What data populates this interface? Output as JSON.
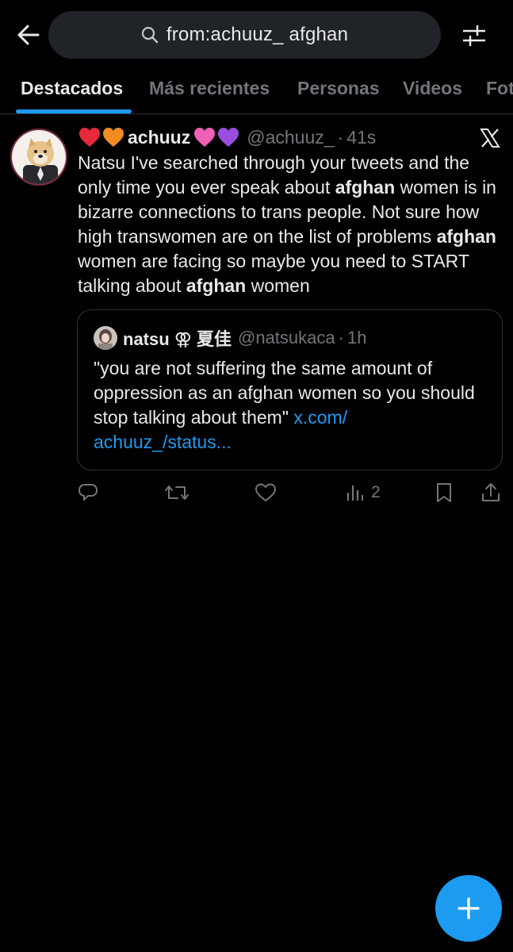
{
  "search": {
    "query": "from:achuuz_ afghan"
  },
  "tabs": [
    {
      "label": "Destacados",
      "active": true
    },
    {
      "label": "Más recientes",
      "active": false
    },
    {
      "label": "Personas",
      "active": false
    },
    {
      "label": "Videos",
      "active": false
    },
    {
      "label": "Fot",
      "active": false
    }
  ],
  "tweet": {
    "name": "achuuz",
    "name_emoji_left": [
      "red-heart",
      "orange-heart"
    ],
    "name_emoji_right": [
      "pink-heart",
      "purple-heart"
    ],
    "handle": "@achuuz_",
    "separator": "·",
    "time": "41s",
    "text_parts": [
      {
        "t": "Natsu I've searched through your tweets and the only time you ever speak about ",
        "b": false
      },
      {
        "t": "afghan",
        "b": true
      },
      {
        "t": " women is in bizarre connections to trans people. Not sure how high transwomen are on the list of problems ",
        "b": false
      },
      {
        "t": "afghan",
        "b": true
      },
      {
        "t": " women are facing so maybe you need to START talking about ",
        "b": false
      },
      {
        "t": "afghan",
        "b": true
      },
      {
        "t": " women",
        "b": false
      }
    ],
    "quote": {
      "name": "natsu ⚢ 夏佳",
      "handle": "@natsukaca",
      "separator": "·",
      "time": "1h",
      "text": "\"you are not suffering the same amount of oppression as an afghan women so you should stop talking about them\" ",
      "link": "x.com/ achuuz_/status..."
    },
    "actions": {
      "reply": "",
      "retweet": "",
      "like": "",
      "views": "2",
      "bookmark": "",
      "share": ""
    }
  },
  "colors": {
    "background": "#000000",
    "accent": "#1d9bf0",
    "text": "#e7e9ea",
    "muted": "#71767b",
    "border": "#2f3336",
    "search_bg": "#202327"
  },
  "icons": {
    "back": "arrow-left-icon",
    "search": "search-icon",
    "filter": "sliders-icon",
    "platform": "x-logo-icon",
    "reply": "reply-icon",
    "retweet": "retweet-icon",
    "like": "heart-icon",
    "views": "views-icon",
    "bookmark": "bookmark-icon",
    "share": "share-icon",
    "compose": "plus-icon"
  }
}
